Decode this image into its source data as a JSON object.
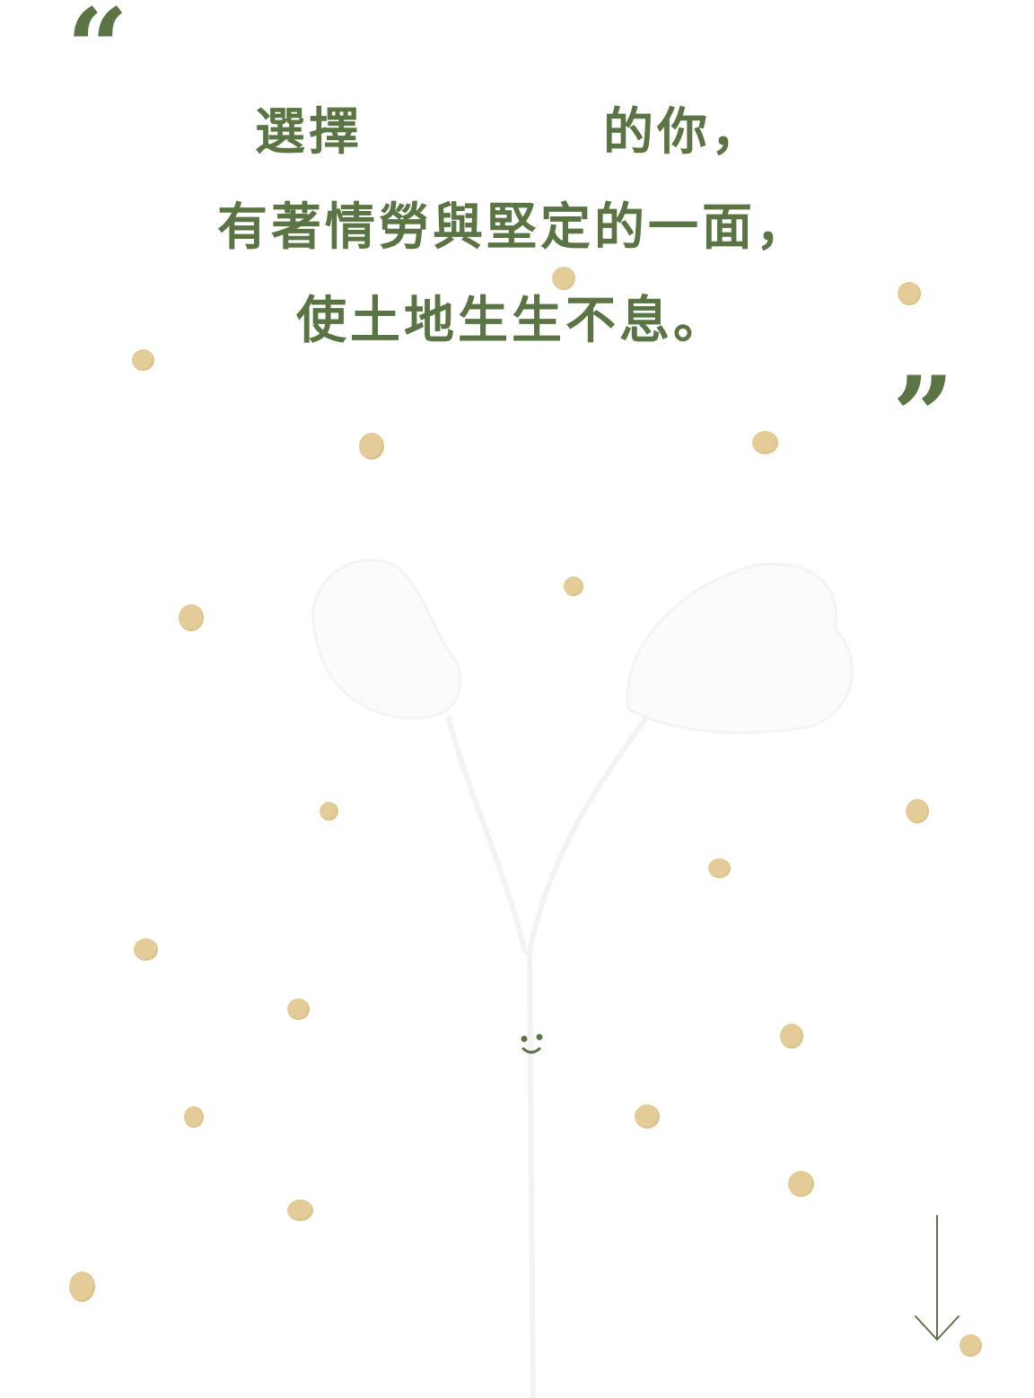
{
  "quote": {
    "open_mark": "“",
    "close_mark": "”",
    "line1_start": "選擇",
    "line1_end": "的你，",
    "line2": "有著情勞與堅定的一面，",
    "line3": "使土地生生不息。"
  },
  "colors": {
    "accent_green": "#5a7444",
    "dot_beige": "#e3cc97",
    "background": "#ffffff"
  },
  "icons": {
    "scroll_indicator": "arrow-down-icon"
  }
}
